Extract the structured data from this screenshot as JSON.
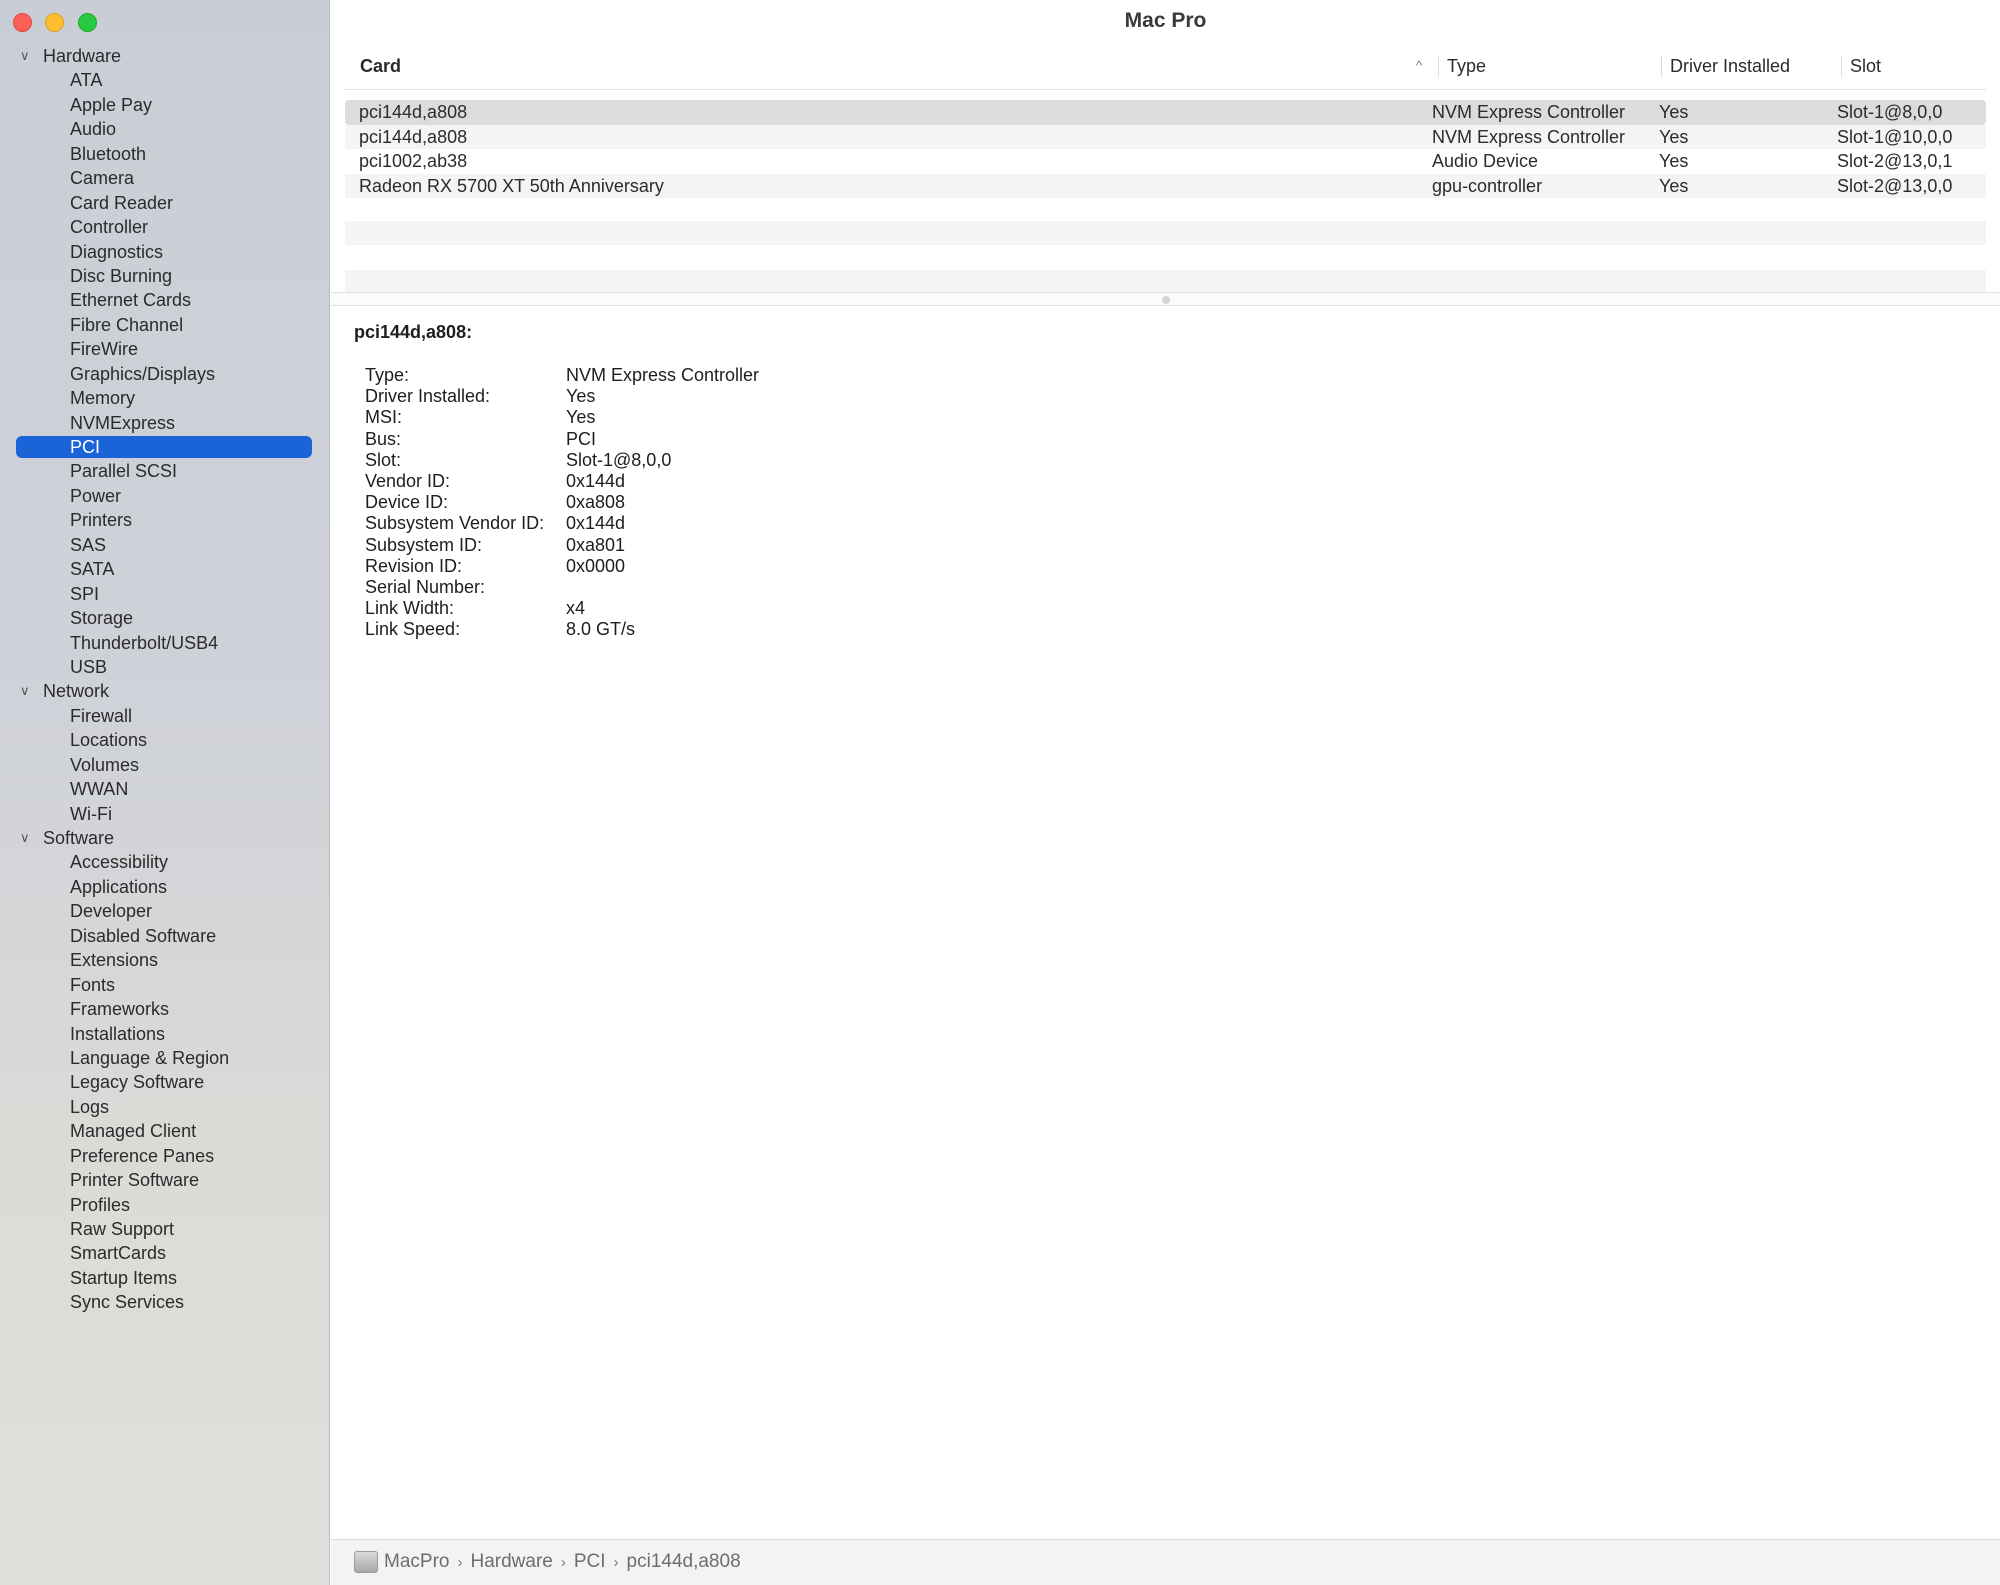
{
  "window": {
    "title": "Mac Pro"
  },
  "sidebar": {
    "groups": [
      {
        "label": "Hardware",
        "items": [
          "ATA",
          "Apple Pay",
          "Audio",
          "Bluetooth",
          "Camera",
          "Card Reader",
          "Controller",
          "Diagnostics",
          "Disc Burning",
          "Ethernet Cards",
          "Fibre Channel",
          "FireWire",
          "Graphics/Displays",
          "Memory",
          "NVMExpress",
          "PCI",
          "Parallel SCSI",
          "Power",
          "Printers",
          "SAS",
          "SATA",
          "SPI",
          "Storage",
          "Thunderbolt/USB4",
          "USB"
        ]
      },
      {
        "label": "Network",
        "items": [
          "Firewall",
          "Locations",
          "Volumes",
          "WWAN",
          "Wi-Fi"
        ]
      },
      {
        "label": "Software",
        "items": [
          "Accessibility",
          "Applications",
          "Developer",
          "Disabled Software",
          "Extensions",
          "Fonts",
          "Frameworks",
          "Installations",
          "Language & Region",
          "Legacy Software",
          "Logs",
          "Managed Client",
          "Preference Panes",
          "Printer Software",
          "Profiles",
          "Raw Support",
          "SmartCards",
          "Startup Items",
          "Sync Services"
        ]
      }
    ],
    "selected": "PCI"
  },
  "table": {
    "headers": {
      "card": "Card",
      "sort_icon": "^",
      "type": "Type",
      "driver": "Driver Installed",
      "slot": "Slot"
    },
    "rows": [
      {
        "card": "pci144d,a808",
        "type": "NVM Express Controller",
        "driver": "Yes",
        "slot": "Slot-1@8,0,0"
      },
      {
        "card": "pci144d,a808",
        "type": "NVM Express Controller",
        "driver": "Yes",
        "slot": "Slot-1@10,0,0"
      },
      {
        "card": "pci1002,ab38",
        "type": "Audio Device",
        "driver": "Yes",
        "slot": "Slot-2@13,0,1"
      },
      {
        "card": "Radeon RX 5700 XT 50th Anniversary",
        "type": "gpu-controller",
        "driver": "Yes",
        "slot": "Slot-2@13,0,0"
      }
    ]
  },
  "detail": {
    "title": "pci144d,a808:",
    "fields": [
      {
        "key": "Type:",
        "value": "NVM Express Controller"
      },
      {
        "key": "Driver Installed:",
        "value": "Yes"
      },
      {
        "key": "MSI:",
        "value": "Yes"
      },
      {
        "key": "Bus:",
        "value": "PCI"
      },
      {
        "key": "Slot:",
        "value": "Slot-1@8,0,0"
      },
      {
        "key": "Vendor ID:",
        "value": "0x144d"
      },
      {
        "key": "Device ID:",
        "value": "0xa808"
      },
      {
        "key": "Subsystem Vendor ID:",
        "value": "0x144d"
      },
      {
        "key": "Subsystem ID:",
        "value": "0xa801"
      },
      {
        "key": "Revision ID:",
        "value": "0x0000"
      },
      {
        "key": "Serial Number:",
        "value": ""
      },
      {
        "key": "Link Width:",
        "value": "x4"
      },
      {
        "key": "Link Speed:",
        "value": "8.0 GT/s"
      }
    ]
  },
  "pathbar": {
    "crumbs": [
      "MacPro",
      "Hardware",
      "PCI",
      "pci144d,a808"
    ],
    "separator": "›"
  },
  "colors": {
    "selection": "#1a64d8",
    "close": "#fe5f57",
    "minimize": "#febc2e",
    "zoom": "#28c840"
  }
}
